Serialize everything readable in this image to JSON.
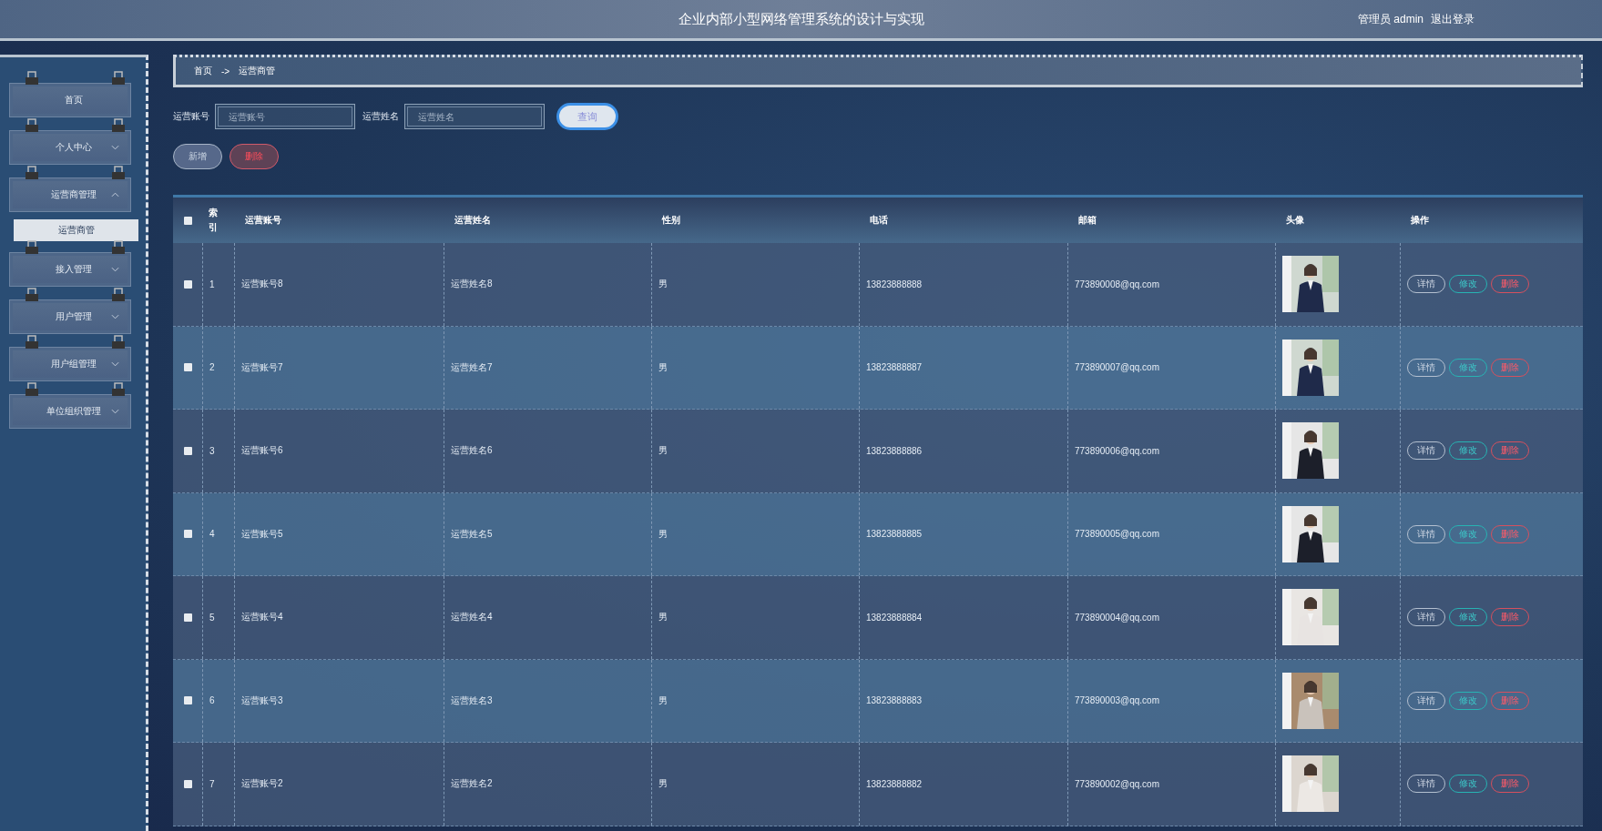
{
  "header": {
    "title": "企业内部小型网络管理系统的设计与实现",
    "user": "管理员 admin",
    "logout": "退出登录"
  },
  "sidebar": {
    "items": [
      {
        "label": "首页",
        "kind": "link"
      },
      {
        "label": "个人中心",
        "kind": "menu",
        "expanded": false
      },
      {
        "label": "运营商管理",
        "kind": "menu",
        "expanded": true,
        "children": [
          {
            "label": "运营商管",
            "selected": true
          }
        ]
      },
      {
        "label": "接入管理",
        "kind": "menu",
        "expanded": false
      },
      {
        "label": "用户管理",
        "kind": "menu",
        "expanded": false
      },
      {
        "label": "用户组管理",
        "kind": "menu",
        "expanded": false
      },
      {
        "label": "单位组织管理",
        "kind": "menu",
        "expanded": false
      }
    ]
  },
  "breadcrumb": [
    "首页",
    "->",
    "运营商管"
  ],
  "search": {
    "fields": [
      {
        "label": "运营账号",
        "placeholder": "运营账号"
      },
      {
        "label": "运营姓名",
        "placeholder": "运营姓名"
      }
    ],
    "button": "查询"
  },
  "actions": [
    {
      "label": "新增",
      "kind": "add"
    },
    {
      "label": "删除",
      "kind": "delete"
    }
  ],
  "table": {
    "select_all": {
      "checked": false
    },
    "columns": [
      "索引",
      "运营账号",
      "运营姓名",
      "性别",
      "电话",
      "邮箱",
      "头像",
      "操作"
    ],
    "rows": [
      {
        "checked": false,
        "index": "1",
        "account": "运营账号8",
        "name": "运营姓名8",
        "gender": "男",
        "phone": "13823888888",
        "email": "773890008@qq.com",
        "ops": [
          "详情",
          "修改",
          "删除"
        ]
      },
      {
        "checked": false,
        "index": "2",
        "account": "运营账号7",
        "name": "运营姓名7",
        "gender": "男",
        "phone": "13823888887",
        "email": "773890007@qq.com",
        "ops": [
          "详情",
          "修改",
          "删除"
        ]
      },
      {
        "checked": false,
        "index": "3",
        "account": "运营账号6",
        "name": "运营姓名6",
        "gender": "男",
        "phone": "13823888886",
        "email": "773890006@qq.com",
        "ops": [
          "详情",
          "修改",
          "删除"
        ]
      },
      {
        "checked": false,
        "index": "4",
        "account": "运营账号5",
        "name": "运营姓名5",
        "gender": "男",
        "phone": "13823888885",
        "email": "773890005@qq.com",
        "ops": [
          "详情",
          "修改",
          "删除"
        ]
      },
      {
        "checked": false,
        "index": "5",
        "account": "运营账号4",
        "name": "运营姓名4",
        "gender": "男",
        "phone": "13823888884",
        "email": "773890004@qq.com",
        "ops": [
          "详情",
          "修改",
          "删除"
        ]
      },
      {
        "checked": false,
        "index": "6",
        "account": "运营账号3",
        "name": "运营姓名3",
        "gender": "男",
        "phone": "13823888883",
        "email": "773890003@qq.com",
        "ops": [
          "详情",
          "修改",
          "删除"
        ]
      },
      {
        "checked": false,
        "index": "7",
        "account": "运营账号2",
        "name": "运营姓名2",
        "gender": "男",
        "phone": "13823888882",
        "email": "773890002@qq.com",
        "ops": [
          "详情",
          "修改",
          "删除"
        ]
      }
    ]
  }
}
